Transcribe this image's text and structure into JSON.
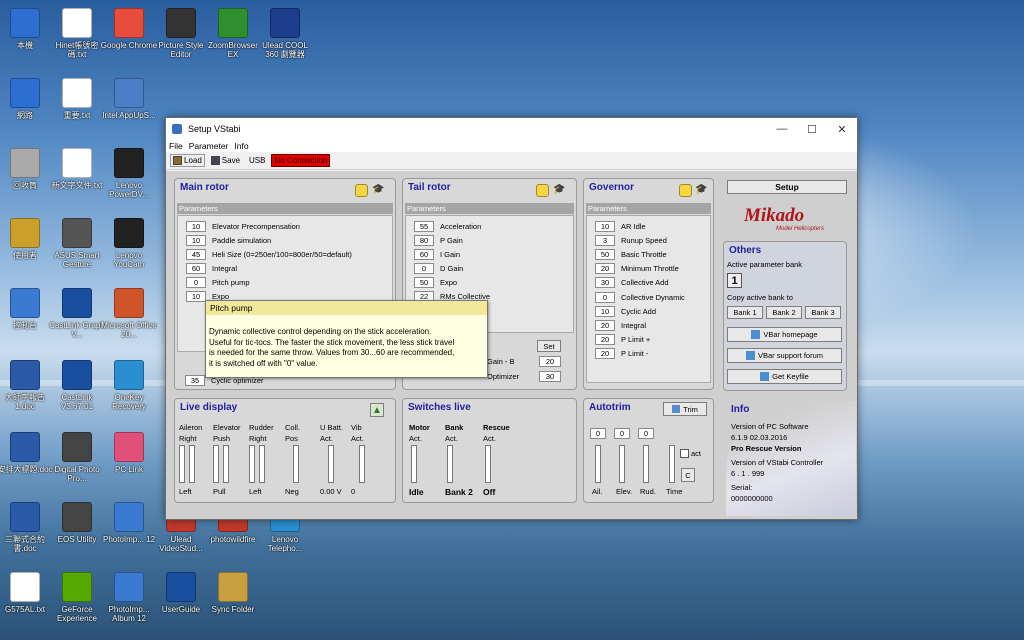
{
  "desktop": {
    "icons": [
      {
        "label": "本機",
        "color": "#2d6fd0"
      },
      {
        "label": "Hinet帳號密碼.txt",
        "color": "#ffffff"
      },
      {
        "label": "Google Chrome",
        "color": "#e74c3c"
      },
      {
        "label": "Picture Style Editor",
        "color": "#333333"
      },
      {
        "label": "ZoomBrowser EX",
        "color": "#2f8f2f"
      },
      {
        "label": "Ulead COOL 360 劇覽器",
        "color": "#1c3c8c"
      },
      {
        "label": "網路",
        "color": "#2d6fd0"
      },
      {
        "label": "重要.txt",
        "color": "#ffffff"
      },
      {
        "label": "Intel AppUpS...",
        "color": "#4a7fc8"
      },
      {
        "label": "回收筒",
        "color": "#aaaaaa"
      },
      {
        "label": "新文字文件.txt",
        "color": "#ffffff"
      },
      {
        "label": "Lenovo PowerDV...",
        "color": "#222222"
      },
      {
        "label": "使用者",
        "color": "#caa02a"
      },
      {
        "label": "ASUS Smart Gesture",
        "color": "#555555"
      },
      {
        "label": "Lenovo YouCam",
        "color": "#222222"
      },
      {
        "label": "控制台",
        "color": "#3a7ad0"
      },
      {
        "label": "CastLink Graph V...",
        "color": "#1a4fa0"
      },
      {
        "label": "Microsoft Office 20...",
        "color": "#d0542a"
      },
      {
        "label": "大師字報告1.doc",
        "color": "#2a5aa8"
      },
      {
        "label": "CastLink V3.67.01",
        "color": "#1a4fa0"
      },
      {
        "label": "OneKey Recovery",
        "color": "#2a8fd0"
      },
      {
        "label": "安排大標題.doc",
        "color": "#2a5aa8"
      },
      {
        "label": "Digital Photo Pro...",
        "color": "#444444"
      },
      {
        "label": "PC Link",
        "color": "#e0507a"
      },
      {
        "label": "三聯式合約書.doc",
        "color": "#2a5aa8"
      },
      {
        "label": "EOS Utility",
        "color": "#444444"
      },
      {
        "label": "PhotoImp... 12",
        "color": "#3a7ad0"
      },
      {
        "label": "Ulead VideoStud...",
        "color": "#c0392b"
      },
      {
        "label": "photowildfire",
        "color": "#c0392b"
      },
      {
        "label": "Lenovo Telepho...",
        "color": "#2a8fd0"
      },
      {
        "label": "G575AL.txt",
        "color": "#ffffff"
      },
      {
        "label": "GeForce Experience",
        "color": "#55a800"
      },
      {
        "label": "PhotoImp... Album 12",
        "color": "#3a7ad0"
      },
      {
        "label": "UserGuide",
        "color": "#1a4fa0"
      },
      {
        "label": "Sync Folder",
        "color": "#c8a040"
      }
    ]
  },
  "window": {
    "title": "Setup VStabi",
    "menu": [
      "File",
      "Parameter",
      "Info"
    ],
    "toolbar": {
      "load": "Load",
      "save": "Save",
      "usb": "USB",
      "no_connection": "No Connection"
    }
  },
  "main_rotor": {
    "title": "Main rotor",
    "params_label": "Parameters",
    "rows": [
      {
        "value": "10",
        "label": "Elevator Precompensation"
      },
      {
        "value": "10",
        "label": "Paddle simulation"
      },
      {
        "value": "45",
        "label": "Heli Size (0=250er/100=800er/50=default)"
      },
      {
        "value": "60",
        "label": "Integral"
      },
      {
        "value": "0",
        "label": "Pitch pump"
      },
      {
        "value": "10",
        "label": "Expo"
      }
    ],
    "bottom_value": "35",
    "bottom_label": "Cyclic optimizer"
  },
  "tail_rotor": {
    "title": "Tail rotor",
    "params_label": "Parameters",
    "rows": [
      {
        "value": "55",
        "label": "Acceleration"
      },
      {
        "value": "80",
        "label": "P Gain"
      },
      {
        "value": "60",
        "label": "I Gain"
      },
      {
        "value": "0",
        "label": "D Gain"
      },
      {
        "value": "50",
        "label": "Expo"
      },
      {
        "value": "22",
        "label": "RMs Collective"
      }
    ],
    "set_label": "Set",
    "gain_text": "Gain   -   B",
    "gain_value": "20",
    "opt_label": "Optimizer",
    "opt_value": "30"
  },
  "governor": {
    "title": "Governor",
    "params_label": "Parameters",
    "rows": [
      {
        "value": "10",
        "label": "AR Idle"
      },
      {
        "value": "3",
        "label": "Runup Speed"
      },
      {
        "value": "50",
        "label": "Basic Throttle"
      },
      {
        "value": "20",
        "label": "Minimum Throttle"
      },
      {
        "value": "30",
        "label": "Collective Add"
      },
      {
        "value": "0",
        "label": "Collective Dynamic"
      },
      {
        "value": "10",
        "label": "Cyclic Add"
      },
      {
        "value": "20",
        "label": "Integral"
      },
      {
        "value": "20",
        "label": "P Limit +"
      },
      {
        "value": "20",
        "label": "P Limit -"
      }
    ]
  },
  "setup": {
    "label": "Setup",
    "logo": "Mikado",
    "logo_sub": "Model Helicopters"
  },
  "others": {
    "title": "Others",
    "active_bank_label": "Active parameter bank",
    "active_bank": "1",
    "copy_label": "Copy active bank to",
    "banks": [
      "Bank 1",
      "Bank 2",
      "Bank 3"
    ],
    "links": [
      "VBar homepage",
      "VBar support forum",
      "Get Keyfile"
    ]
  },
  "live": {
    "title": "Live display",
    "cols": [
      {
        "head": "Aileron",
        "sub": "Right",
        "foot": "Left"
      },
      {
        "head": "Elevator",
        "sub": "Push",
        "foot": "Pull"
      },
      {
        "head": "Rudder",
        "sub": "Right",
        "foot": "Left"
      },
      {
        "head": "Coll.",
        "sub": "Pos",
        "foot": "Neg"
      },
      {
        "head": "U Batt.",
        "sub": "Act.",
        "foot": "0.00 V"
      },
      {
        "head": "Vib",
        "sub": "Act.",
        "foot": "0"
      }
    ]
  },
  "switches": {
    "title": "Switches live",
    "cols": [
      {
        "head": "Motor",
        "sub": "Act.",
        "foot": "Idle"
      },
      {
        "head": "Bank",
        "sub": "Act.",
        "foot": "Bank 2"
      },
      {
        "head": "Rescue",
        "sub": "Act.",
        "foot": "Off"
      }
    ]
  },
  "autotrim": {
    "title": "Autotrim",
    "trim_button": "Trim",
    "values": [
      "0",
      "0",
      "0"
    ],
    "cols": [
      "Ail.",
      "Elev.",
      "Rud.",
      "Time"
    ],
    "act": "act",
    "c": "C"
  },
  "info": {
    "title": "Info",
    "pc_label": "Version of PC Software",
    "pc_version": "6.1.9   02.03.2016",
    "edition": "Pro Rescue Version",
    "ctrl_label": "Version of VStabi Controller",
    "ctrl_version": "6   .   1   .   999",
    "serial_label": "Serial:",
    "serial": "0000000000"
  },
  "tooltip": {
    "title": "Pitch pump",
    "lines": [
      "Dynamic collective control depending on the stick acceleration.",
      "Useful for tic-tocs. The faster the stick movement, the less stick travel",
      "is needed for the same throw. Values from 30...60 are recommended,",
      "it is switched off with \"0\" value."
    ]
  }
}
